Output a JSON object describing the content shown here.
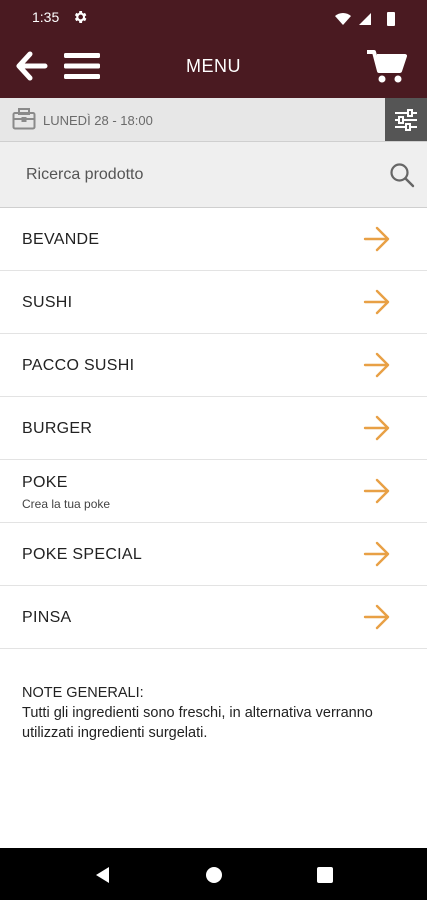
{
  "status": {
    "time": "1:35"
  },
  "header": {
    "title": "MENU"
  },
  "date_bar": {
    "label": "LUNEDÌ 28 - 18:00"
  },
  "search": {
    "placeholder": "Ricerca prodotto"
  },
  "menu": {
    "items": [
      {
        "label": "BEVANDE",
        "subtitle": ""
      },
      {
        "label": "SUSHI",
        "subtitle": ""
      },
      {
        "label": "PACCO SUSHI",
        "subtitle": ""
      },
      {
        "label": "BURGER",
        "subtitle": ""
      },
      {
        "label": "POKE",
        "subtitle": "Crea la tua poke"
      },
      {
        "label": "POKE SPECIAL",
        "subtitle": ""
      },
      {
        "label": "PINSA",
        "subtitle": ""
      }
    ]
  },
  "notes": {
    "title": "NOTE GENERALI:",
    "text": "Tutti gli ingredienti sono freschi, in alternativa verranno utilizzati ingredienti surgelati."
  },
  "colors": {
    "header_bg": "#4a1a21",
    "arrow": "#e8a045",
    "filter_bg": "#555555",
    "date_bar_bg": "#e7e7e7"
  },
  "icons": [
    "gear-icon",
    "wifi-icon",
    "signal-icon",
    "battery-icon",
    "back-arrow-icon",
    "hamburger-menu-icon",
    "cart-icon",
    "calendar-icon",
    "filter-sliders-icon",
    "search-icon",
    "arrow-right-icon",
    "nav-back-icon",
    "nav-home-icon",
    "nav-recents-icon"
  ]
}
